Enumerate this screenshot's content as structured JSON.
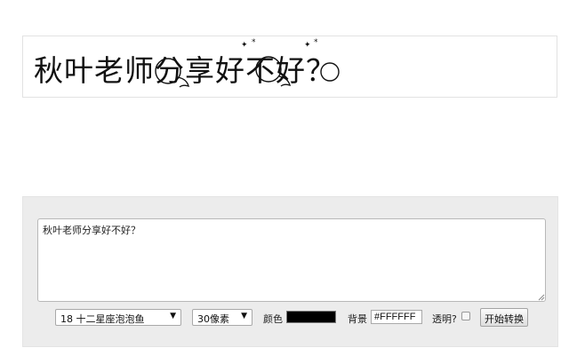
{
  "preview": {
    "rendered_text": "秋叶老师分享好不好？"
  },
  "editor": {
    "input_text": "秋叶老师分享好不好？"
  },
  "toolbar": {
    "font_select": "18 十二星座泡泡鱼",
    "size_select": "30像素",
    "color_label": "颜色",
    "color_value": "#000000",
    "background_label": "背景",
    "background_value": "#FFFFFF",
    "transparent_label": "透明?",
    "transparent_checked": false,
    "convert_button": "开始转换"
  },
  "icons": {
    "select_arrow": "dropdown-arrow-icon"
  }
}
